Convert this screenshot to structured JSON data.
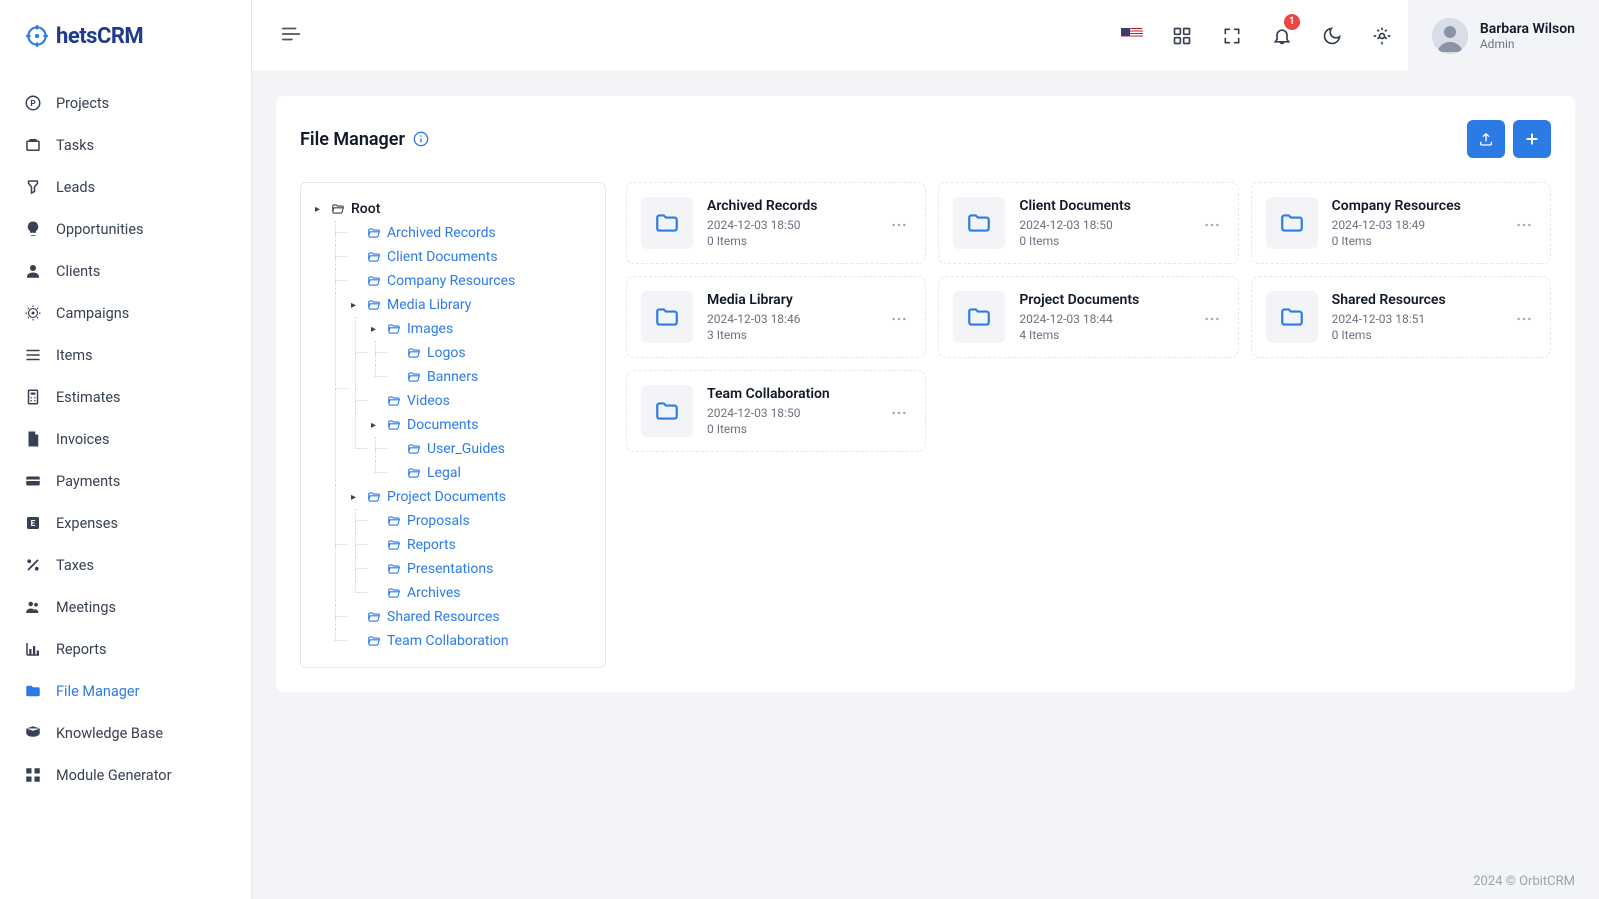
{
  "brand": {
    "name": "hetsCRM"
  },
  "user": {
    "name": "Barbara Wilson",
    "role": "Admin"
  },
  "notifications": {
    "count": "1"
  },
  "sidebar": {
    "items": [
      {
        "label": "Projects",
        "icon": "projects"
      },
      {
        "label": "Tasks",
        "icon": "tasks"
      },
      {
        "label": "Leads",
        "icon": "leads"
      },
      {
        "label": "Opportunities",
        "icon": "opportunities"
      },
      {
        "label": "Clients",
        "icon": "clients"
      },
      {
        "label": "Campaigns",
        "icon": "campaigns"
      },
      {
        "label": "Items",
        "icon": "items"
      },
      {
        "label": "Estimates",
        "icon": "estimates"
      },
      {
        "label": "Invoices",
        "icon": "invoices"
      },
      {
        "label": "Payments",
        "icon": "payments"
      },
      {
        "label": "Expenses",
        "icon": "expenses"
      },
      {
        "label": "Taxes",
        "icon": "taxes"
      },
      {
        "label": "Meetings",
        "icon": "meetings"
      },
      {
        "label": "Reports",
        "icon": "reports"
      },
      {
        "label": "File Manager",
        "icon": "file-manager",
        "active": true
      },
      {
        "label": "Knowledge Base",
        "icon": "knowledge"
      },
      {
        "label": "Module Generator",
        "icon": "module"
      }
    ]
  },
  "page": {
    "title": "File Manager"
  },
  "tree": {
    "root": "Root",
    "nodes": [
      {
        "label": "Archived Records"
      },
      {
        "label": "Client Documents"
      },
      {
        "label": "Company Resources"
      },
      {
        "label": "Media Library",
        "expanded": true,
        "children": [
          {
            "label": "Images",
            "expanded": true,
            "children": [
              {
                "label": "Logos"
              },
              {
                "label": "Banners"
              }
            ]
          },
          {
            "label": "Videos"
          },
          {
            "label": "Documents",
            "expanded": true,
            "children": [
              {
                "label": "User_Guides"
              },
              {
                "label": "Legal"
              }
            ]
          }
        ]
      },
      {
        "label": "Project Documents",
        "expanded": true,
        "children": [
          {
            "label": "Proposals"
          },
          {
            "label": "Reports"
          },
          {
            "label": "Presentations"
          },
          {
            "label": "Archives"
          }
        ]
      },
      {
        "label": "Shared Resources"
      },
      {
        "label": "Team Collaboration"
      }
    ]
  },
  "folders": [
    {
      "name": "Archived Records",
      "date": "2024-12-03 18:50",
      "count": "0 Items"
    },
    {
      "name": "Client Documents",
      "date": "2024-12-03 18:50",
      "count": "0 Items"
    },
    {
      "name": "Company Resources",
      "date": "2024-12-03 18:49",
      "count": "0 Items"
    },
    {
      "name": "Media Library",
      "date": "2024-12-03 18:46",
      "count": "3 Items"
    },
    {
      "name": "Project Documents",
      "date": "2024-12-03 18:44",
      "count": "4 Items"
    },
    {
      "name": "Shared Resources",
      "date": "2024-12-03 18:51",
      "count": "0 Items"
    },
    {
      "name": "Team Collaboration",
      "date": "2024-12-03 18:50",
      "count": "0 Items"
    }
  ],
  "footer": {
    "text": "2024 © OrbitCRM"
  }
}
